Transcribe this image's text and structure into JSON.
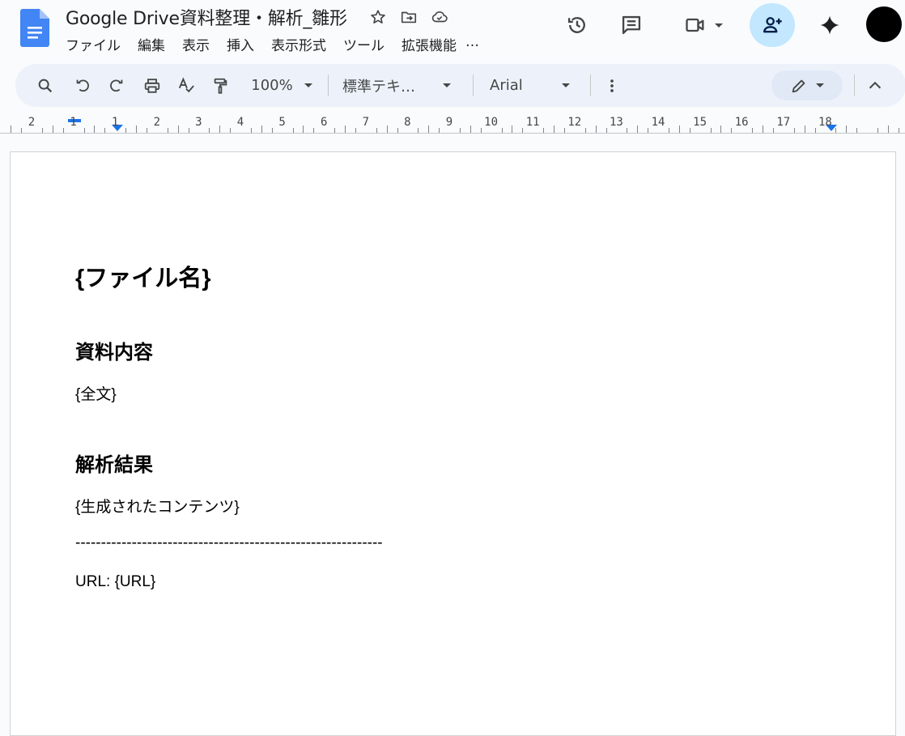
{
  "header": {
    "title": "Google Drive資料整理・解析_雛形",
    "menu": [
      "ファイル",
      "編集",
      "表示",
      "挿入",
      "表示形式",
      "ツール",
      "拡張機能"
    ],
    "menu_more": "…"
  },
  "toolbar": {
    "zoom": "100%",
    "style": "標準テキ…",
    "font": "Arial"
  },
  "ruler": {
    "numbers": [
      "2",
      "1",
      "1",
      "2",
      "3",
      "4",
      "5",
      "6",
      "7",
      "8",
      "9",
      "10",
      "11",
      "12",
      "13",
      "14",
      "15",
      "16",
      "17",
      "18"
    ]
  },
  "document": {
    "title": "{ファイル名}",
    "section1_heading": "資料内容",
    "section1_body": "{全文}",
    "section2_heading": "解析結果",
    "section2_body": "{生成されたコンテンツ}",
    "divider": "------------------------------------------------------------",
    "url_line": "URL: {URL}"
  },
  "colors": {
    "accent": "#1a73e8",
    "share_bg": "#c2e7ff",
    "toolbar_bg": "#edf2fa"
  }
}
